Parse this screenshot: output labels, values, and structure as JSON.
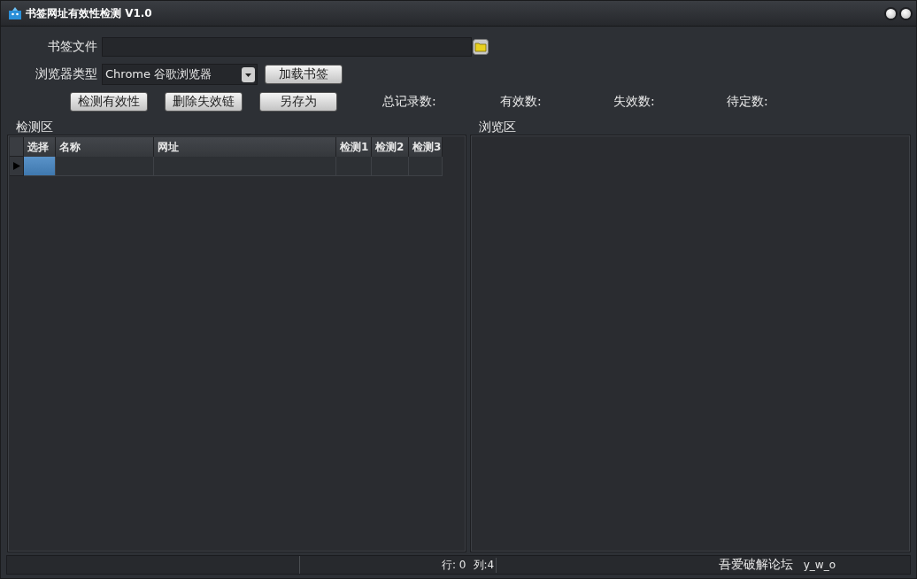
{
  "window": {
    "title": "书签网址有效性检测 V1.0"
  },
  "form": {
    "file_label": "书签文件",
    "browser_label": "浏览器类型",
    "browser_value": "Chrome 谷歌浏览器"
  },
  "buttons": [
    {
      "label": "加载书签"
    },
    {
      "label": "检测有效性"
    },
    {
      "label": "删除失效链"
    },
    {
      "label": "另存为"
    }
  ],
  "stats": [
    "总记录数:",
    "有效数:",
    "失效数:",
    "待定数:"
  ],
  "check_panel": {
    "title": "检测区",
    "columns": [
      "选择",
      "名称",
      "网址",
      "检测1",
      "检测2",
      "检测3"
    ],
    "rows": [
      {
        "current": true
      }
    ]
  },
  "browse_panel": {
    "title": "浏览区"
  },
  "status_bar": {
    "row": "行: 0",
    "column": "列:4",
    "site": "吾爱破解论坛",
    "user": "y_w_o"
  }
}
